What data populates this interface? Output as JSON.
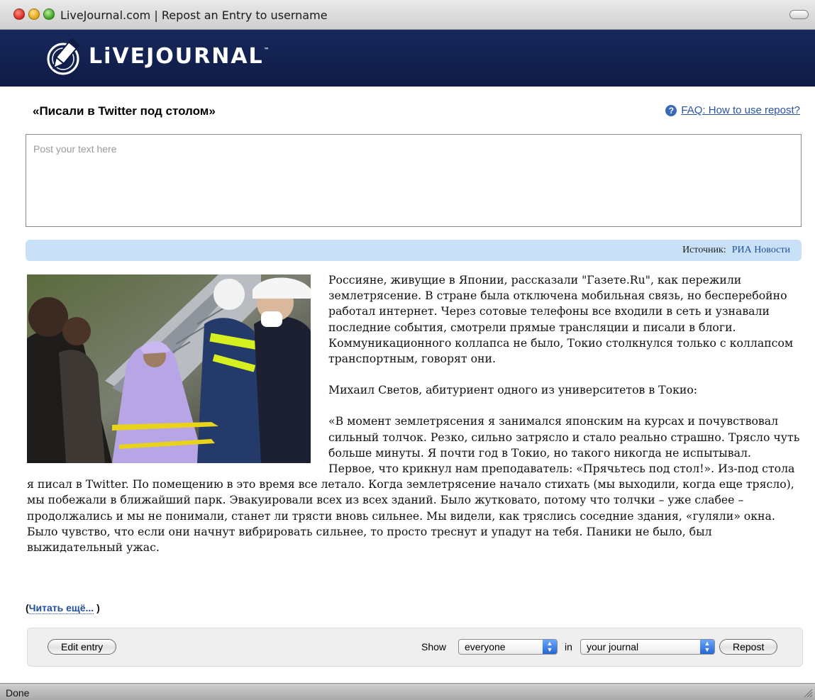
{
  "window": {
    "title": "LiveJournal.com | Repost an Entry to username",
    "status": "Done"
  },
  "brand": {
    "wordmark": "LiVEJOURNAL",
    "trademark": "™",
    "header_color": "#14224f"
  },
  "entry": {
    "title": "«Писали в Twitter под столом»",
    "faq_label": "FAQ: How to use repost?",
    "textarea_placeholder": "Post your text here"
  },
  "source": {
    "label": "Источник:",
    "name": "РИА Новости"
  },
  "article": {
    "photo_icon": "photo-earthquake-tokyo",
    "paragraph_1": "Россияне, живущие в Японии, рассказали \"Газете.Ru\", как пережили землетрясение. В стране была отключена мобильная связь, но бесперебойно работал интернет. Через сотовые телефоны все входили в сеть и узнавали последние события, смотрели прямые трансляции и писали в блоги. Коммуникационного коллапса не было, Токио столкнулся только с коллапсом транспортным, говорят они.",
    "paragraph_2": "Михаил Светов, абитуриент одного из университетов в Токио:",
    "paragraph_3": "«В момент землетрясения я занимался японским на курсах и почувствовал сильный толчок. Резко, сильно затрясло и стало реально страшно. Трясло чуть больше минуты. Я почти год в Токио, но такого никогда не испытывал.",
    "paragraph_4": "Первое, что крикнул нам преподаватель: «Прячьтесь под стол!». Из-под стола я писал в Twitter. По помещению в это время все летало. Когда землетрясение начало стихать (мы выходили, когда еще трясло), мы побежали в ближайший парк. Эвакуировали всех из всех зданий. Было жутковато, потому что толчки – уже слабее – продолжались и мы не понимали, станет ли трясти вновь сильнее. Мы видели, как тряслись соседние здания, «гуляли» окна. Было чувство, что если они начнут вибрировать сильнее, то просто треснут и упадут на тебя. Паники не было, был выжидательный ужас.",
    "read_more_open": "(",
    "read_more_label": "Читать ещё...",
    "read_more_close": ")"
  },
  "toolbar": {
    "edit_label": "Edit entry",
    "show_label": "Show",
    "visibility_value": "everyone",
    "in_label": "in",
    "target_value": "your journal",
    "repost_label": "Repost"
  }
}
